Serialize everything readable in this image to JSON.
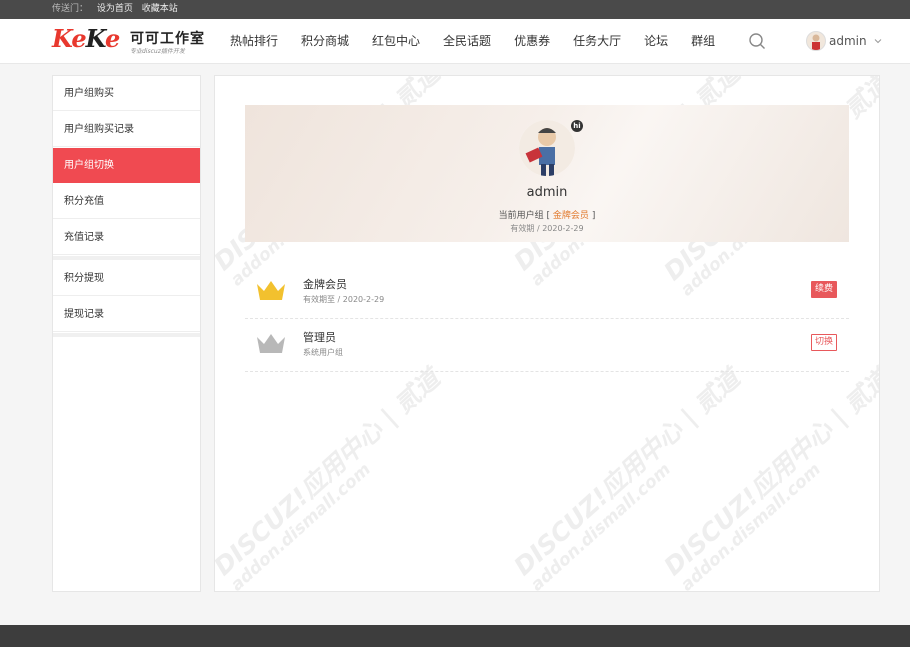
{
  "topbar": {
    "prefix": "传送门：",
    "links": [
      "设为首页",
      "收藏本站"
    ]
  },
  "brand": {
    "logo_text": "KeKe",
    "name": "可可工作室",
    "tagline": "专业discuz插件开发"
  },
  "nav": {
    "items": [
      "热帖排行",
      "积分商城",
      "红包中心",
      "全民话题",
      "优惠券",
      "任务大厅",
      "论坛",
      "群组"
    ]
  },
  "user": {
    "name": "admin"
  },
  "sidebar": {
    "items": [
      "用户组购买",
      "用户组购买记录",
      "用户组切换",
      "积分充值",
      "充值记录",
      "积分提现",
      "提现记录"
    ],
    "active_index": 2
  },
  "banner": {
    "username": "admin",
    "badge": "hi",
    "current_group_label": "当前用户组 [",
    "current_group": "金牌会员",
    "current_group_close": "]",
    "expiry_label": "有效期 / ",
    "expiry": "2020-2-29"
  },
  "groups": [
    {
      "name": "金牌会员",
      "sub": "有效期至 / 2020-2-29",
      "action": "续费",
      "crown_color": "#f2c12e"
    },
    {
      "name": "管理员",
      "sub": "系统用户组",
      "action": "切换",
      "crown_color": "#b8b8b8"
    }
  ],
  "watermark": {
    "line1": "DISCUZ!应用中心 | 贰道",
    "line2": "addon.dismall.com"
  },
  "colors": {
    "accent": "#f04a51",
    "gold": "#f2c12e",
    "gray_crown": "#b8b8b8",
    "link_orange": "#e27a2e"
  }
}
